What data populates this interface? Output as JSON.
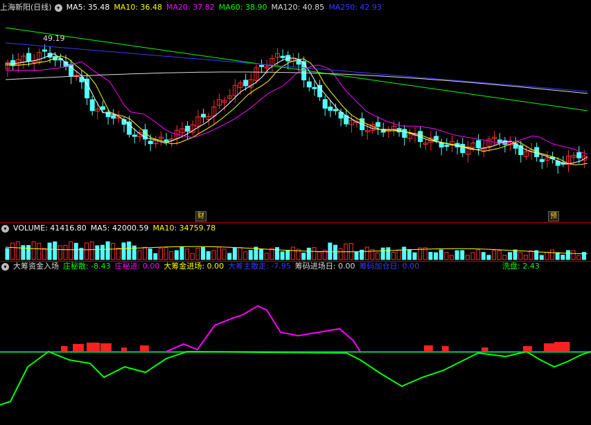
{
  "price_panel": {
    "title": "上海新阳(日线)",
    "ma": [
      {
        "label": "MA5: 35.48",
        "color": "#ffffff"
      },
      {
        "label": "MA10: 36.48",
        "color": "#ffff00"
      },
      {
        "label": "MA20: 37.82",
        "color": "#ff00ff"
      },
      {
        "label": "MA60: 38.90",
        "color": "#00ff00"
      },
      {
        "label": "MA120: 40.85",
        "color": "#dddddd"
      },
      {
        "label": "MA250: 42.93",
        "color": "#3a3aff"
      }
    ],
    "high_marker": "49.19",
    "event_tags": [
      "财",
      "预"
    ]
  },
  "volume_panel": {
    "items": [
      {
        "label": "VOLUME: 41416.80",
        "color": "#ffffff"
      },
      {
        "label": "MA5: 42000.59",
        "color": "#ffffff"
      },
      {
        "label": "MA10: 34759.78",
        "color": "#ffff00"
      }
    ]
  },
  "indicator_panel": {
    "title": "大筹资金入场",
    "items": [
      {
        "label": "庄秘散: -8.43",
        "color": "#00ff00"
      },
      {
        "label": "庄秘进: 0.00",
        "color": "#ff00ff"
      },
      {
        "label": "大筹金进场: 0.00",
        "color": "#ffff00"
      },
      {
        "label": "大筹主散走: -7.95",
        "color": "#3a3aff"
      },
      {
        "label": "筹码进场日: 0.00",
        "color": "#dddddd"
      },
      {
        "label": "筹码加仓日: 0.00",
        "color": "#3a3aff"
      }
    ],
    "wash_label": "洗盘: 2.43",
    "wash_color": "#00ff00"
  },
  "colors": {
    "up": "#ff3030",
    "down": "#54ffff",
    "separator": "#b00000",
    "background": "#000000"
  }
}
